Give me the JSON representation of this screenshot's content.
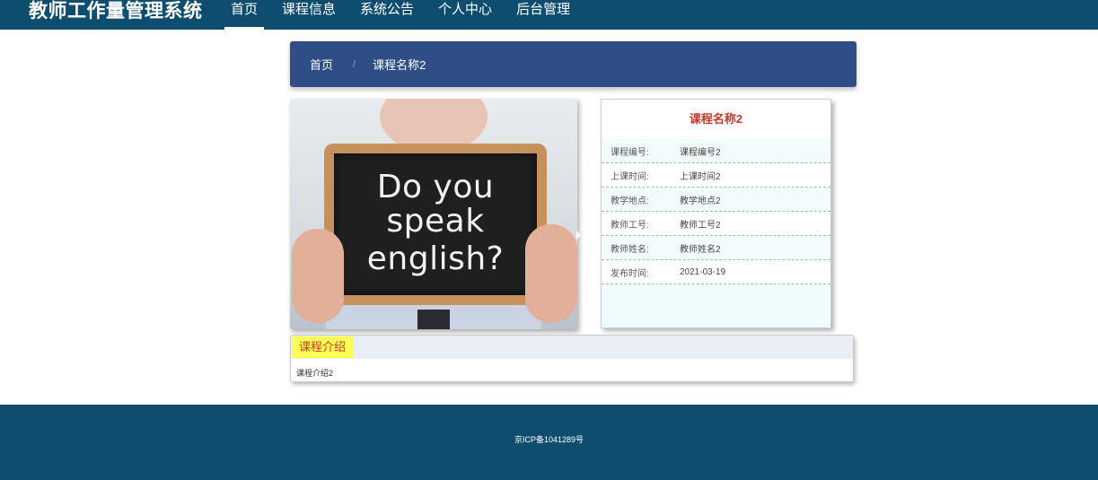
{
  "app": {
    "title": "教师工作量管理系统"
  },
  "nav": {
    "items": [
      {
        "label": "首页"
      },
      {
        "label": "课程信息"
      },
      {
        "label": "系统公告"
      },
      {
        "label": "个人中心"
      },
      {
        "label": "后台管理"
      }
    ],
    "active_index": 0
  },
  "breadcrumb": {
    "home": "首页",
    "separator": "/",
    "current": "课程名称2"
  },
  "course_image": {
    "board_lines": [
      "Do you",
      "speak",
      "english?"
    ]
  },
  "course": {
    "title": "课程名称2",
    "fields": [
      {
        "label": "课程编号:",
        "value": "课程编号2"
      },
      {
        "label": "上课时间:",
        "value": "上课时间2"
      },
      {
        "label": "教学地点:",
        "value": "教学地点2"
      },
      {
        "label": "教师工号:",
        "value": "教师工号2"
      },
      {
        "label": "教师姓名:",
        "value": "教师姓名2"
      },
      {
        "label": "发布时间:",
        "value": "2021-03-19"
      }
    ]
  },
  "intro": {
    "title": "课程介绍",
    "content": "课程介绍2"
  },
  "footer": {
    "icp": "京ICP备1041289号"
  },
  "colors": {
    "primary": "#0e4d6e",
    "breadcrumb_bg": "#2f4e86",
    "title_red": "#c0392b",
    "highlight": "#ffff55"
  }
}
